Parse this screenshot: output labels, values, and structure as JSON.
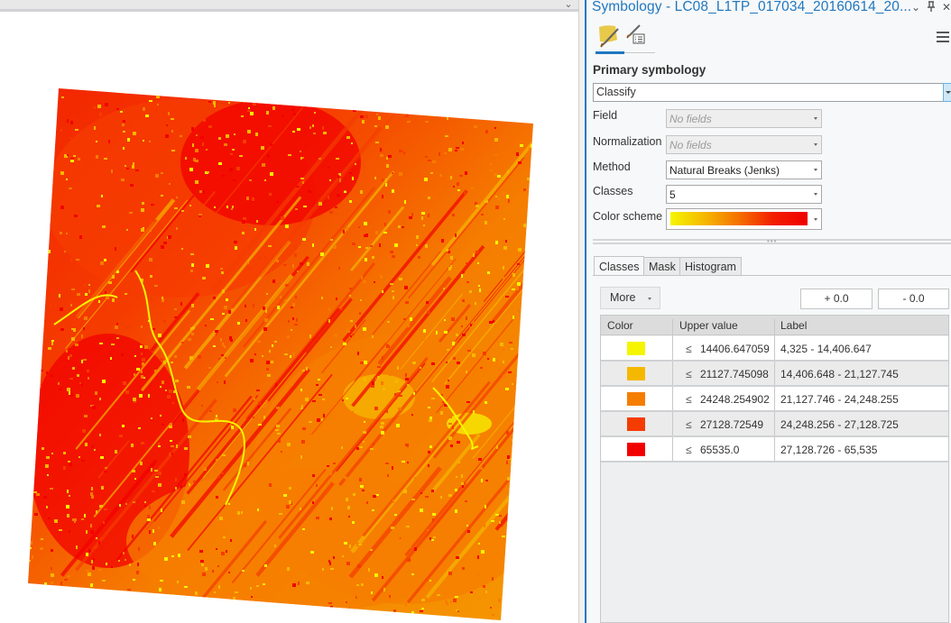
{
  "map": {
    "collapse_icon": "chevron-down-icon",
    "raster_name": "LC08_L1TP_017034_20160614_20..."
  },
  "pane": {
    "title": "Symbology - LC08_L1TP_017034_20160614_20...",
    "header_buttons": [
      {
        "name": "options-dropdown",
        "icon": "chevron-down-icon",
        "glyph": "⌄"
      },
      {
        "name": "auto-hide",
        "icon": "pin-icon",
        "glyph": "ᛘ"
      },
      {
        "name": "close",
        "icon": "close-icon",
        "glyph": "✕"
      }
    ],
    "tabs": [
      {
        "name": "primary-symbology",
        "icon": "paintbrush-icon",
        "active": true
      },
      {
        "name": "secondary-symbology",
        "icon": "paintbrush-list-icon",
        "active": false
      }
    ],
    "menu_icon": "hamburger-menu-icon"
  },
  "primary": {
    "section_title": "Primary symbology",
    "renderer": "Classify",
    "fields": [
      {
        "label": "Field",
        "value": "No fields",
        "disabled": true
      },
      {
        "label": "Normalization",
        "value": "No fields",
        "disabled": true
      },
      {
        "label": "Method",
        "value": "Natural Breaks (Jenks)",
        "disabled": false
      },
      {
        "label": "Classes",
        "value": "5",
        "disabled": false
      }
    ],
    "color_scheme_label": "Color scheme",
    "color_scheme": [
      "#f5f500",
      "#f5b800",
      "#f57000",
      "#f21e00",
      "#f00000"
    ]
  },
  "class_tabs": [
    {
      "label": "Classes",
      "active": true
    },
    {
      "label": "Mask",
      "active": false
    },
    {
      "label": "Histogram",
      "active": false
    }
  ],
  "toolbar": {
    "more_label": "More",
    "shift_up": "+ 0.0",
    "shift_down": "- 0.0"
  },
  "table": {
    "headers": [
      "Color",
      "Upper value",
      "Label"
    ],
    "le_symbol": "≤",
    "rows": [
      {
        "color": "#f5f500",
        "upper": "14406.647059",
        "label": "4,325 - 14,406.647"
      },
      {
        "color": "#f5b800",
        "upper": "21127.745098",
        "label": "14,406.648 - 21,127.745"
      },
      {
        "color": "#f57d00",
        "upper": "24248.254902",
        "label": "21,127.746 - 24,248.255"
      },
      {
        "color": "#f53c00",
        "upper": "27128.72549",
        "label": "24,248.256 - 27,128.725"
      },
      {
        "color": "#f20000",
        "upper": "65535.0",
        "label": "27,128.726 - 65,535"
      }
    ]
  }
}
